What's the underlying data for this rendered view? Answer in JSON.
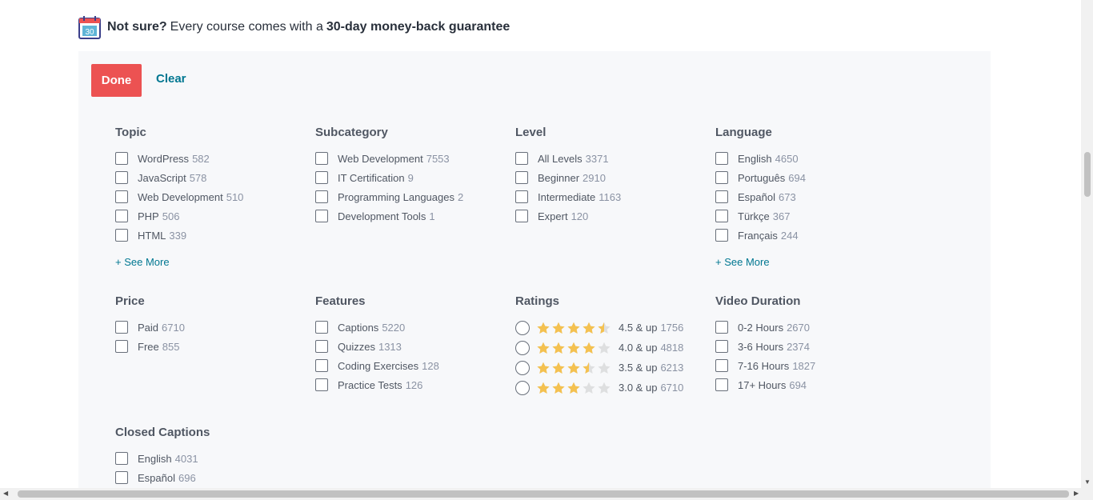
{
  "banner": {
    "calendar_number": "30",
    "bold_lead": "Not sure?",
    "middle": "Every course comes with a",
    "bold_tail": "30-day money-back guarantee"
  },
  "actions": {
    "done_label": "Done",
    "clear_label": "Clear"
  },
  "see_more_label": "+ See More",
  "colors": {
    "accent": "#ec5252",
    "link": "#007791",
    "star": "#f4c150",
    "panel": "#f7f8fa"
  },
  "filters": {
    "topic": {
      "title": "Topic",
      "options": [
        {
          "label": "WordPress",
          "count": "582"
        },
        {
          "label": "JavaScript",
          "count": "578"
        },
        {
          "label": "Web Development",
          "count": "510"
        },
        {
          "label": "PHP",
          "count": "506"
        },
        {
          "label": "HTML",
          "count": "339"
        }
      ]
    },
    "subcategory": {
      "title": "Subcategory",
      "options": [
        {
          "label": "Web Development",
          "count": "7553"
        },
        {
          "label": "IT Certification",
          "count": "9"
        },
        {
          "label": "Programming Languages",
          "count": "2"
        },
        {
          "label": "Development Tools",
          "count": "1"
        }
      ]
    },
    "level": {
      "title": "Level",
      "options": [
        {
          "label": "All Levels",
          "count": "3371"
        },
        {
          "label": "Beginner",
          "count": "2910"
        },
        {
          "label": "Intermediate",
          "count": "1163"
        },
        {
          "label": "Expert",
          "count": "120"
        }
      ]
    },
    "language": {
      "title": "Language",
      "options": [
        {
          "label": "English",
          "count": "4650"
        },
        {
          "label": "Português",
          "count": "694"
        },
        {
          "label": "Español",
          "count": "673"
        },
        {
          "label": "Türkçe",
          "count": "367"
        },
        {
          "label": "Français",
          "count": "244"
        }
      ]
    },
    "price": {
      "title": "Price",
      "options": [
        {
          "label": "Paid",
          "count": "6710"
        },
        {
          "label": "Free",
          "count": "855"
        }
      ]
    },
    "features": {
      "title": "Features",
      "options": [
        {
          "label": "Captions",
          "count": "5220"
        },
        {
          "label": "Quizzes",
          "count": "1313"
        },
        {
          "label": "Coding Exercises",
          "count": "128"
        },
        {
          "label": "Practice Tests",
          "count": "126"
        }
      ]
    },
    "ratings": {
      "title": "Ratings",
      "options": [
        {
          "stars": 4.5,
          "label": "4.5 & up",
          "count": "1756"
        },
        {
          "stars": 4.0,
          "label": "4.0 & up",
          "count": "4818"
        },
        {
          "stars": 3.5,
          "label": "3.5 & up",
          "count": "6213"
        },
        {
          "stars": 3.0,
          "label": "3.0 & up",
          "count": "6710"
        }
      ]
    },
    "video_duration": {
      "title": "Video Duration",
      "options": [
        {
          "label": "0-2 Hours",
          "count": "2670"
        },
        {
          "label": "3-6 Hours",
          "count": "2374"
        },
        {
          "label": "7-16 Hours",
          "count": "1827"
        },
        {
          "label": "17+ Hours",
          "count": "694"
        }
      ]
    },
    "closed_captions": {
      "title": "Closed Captions",
      "options": [
        {
          "label": "English",
          "count": "4031"
        },
        {
          "label": "Español",
          "count": "696"
        }
      ]
    }
  }
}
